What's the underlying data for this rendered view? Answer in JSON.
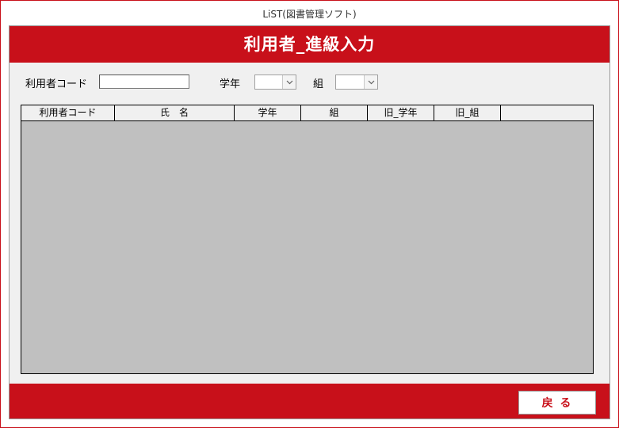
{
  "window": {
    "title": "LiST(図書管理ソフト)"
  },
  "header": {
    "title": "利用者_進級入力"
  },
  "filters": {
    "user_code_label": "利用者コード",
    "user_code_value": "",
    "grade_label": "学年",
    "grade_value": "",
    "class_label": "組",
    "class_value": ""
  },
  "grid": {
    "columns": [
      "利用者コード",
      "氏　名",
      "学年",
      "組",
      "旧_学年",
      "旧_組",
      ""
    ],
    "rows": []
  },
  "footer": {
    "back_label": "戻 る"
  },
  "colors": {
    "accent": "#c8101a",
    "panel": "#f0f0f0",
    "grid_body": "#c0c0c0"
  },
  "icons": {
    "dropdown": "chevron-down-icon"
  }
}
